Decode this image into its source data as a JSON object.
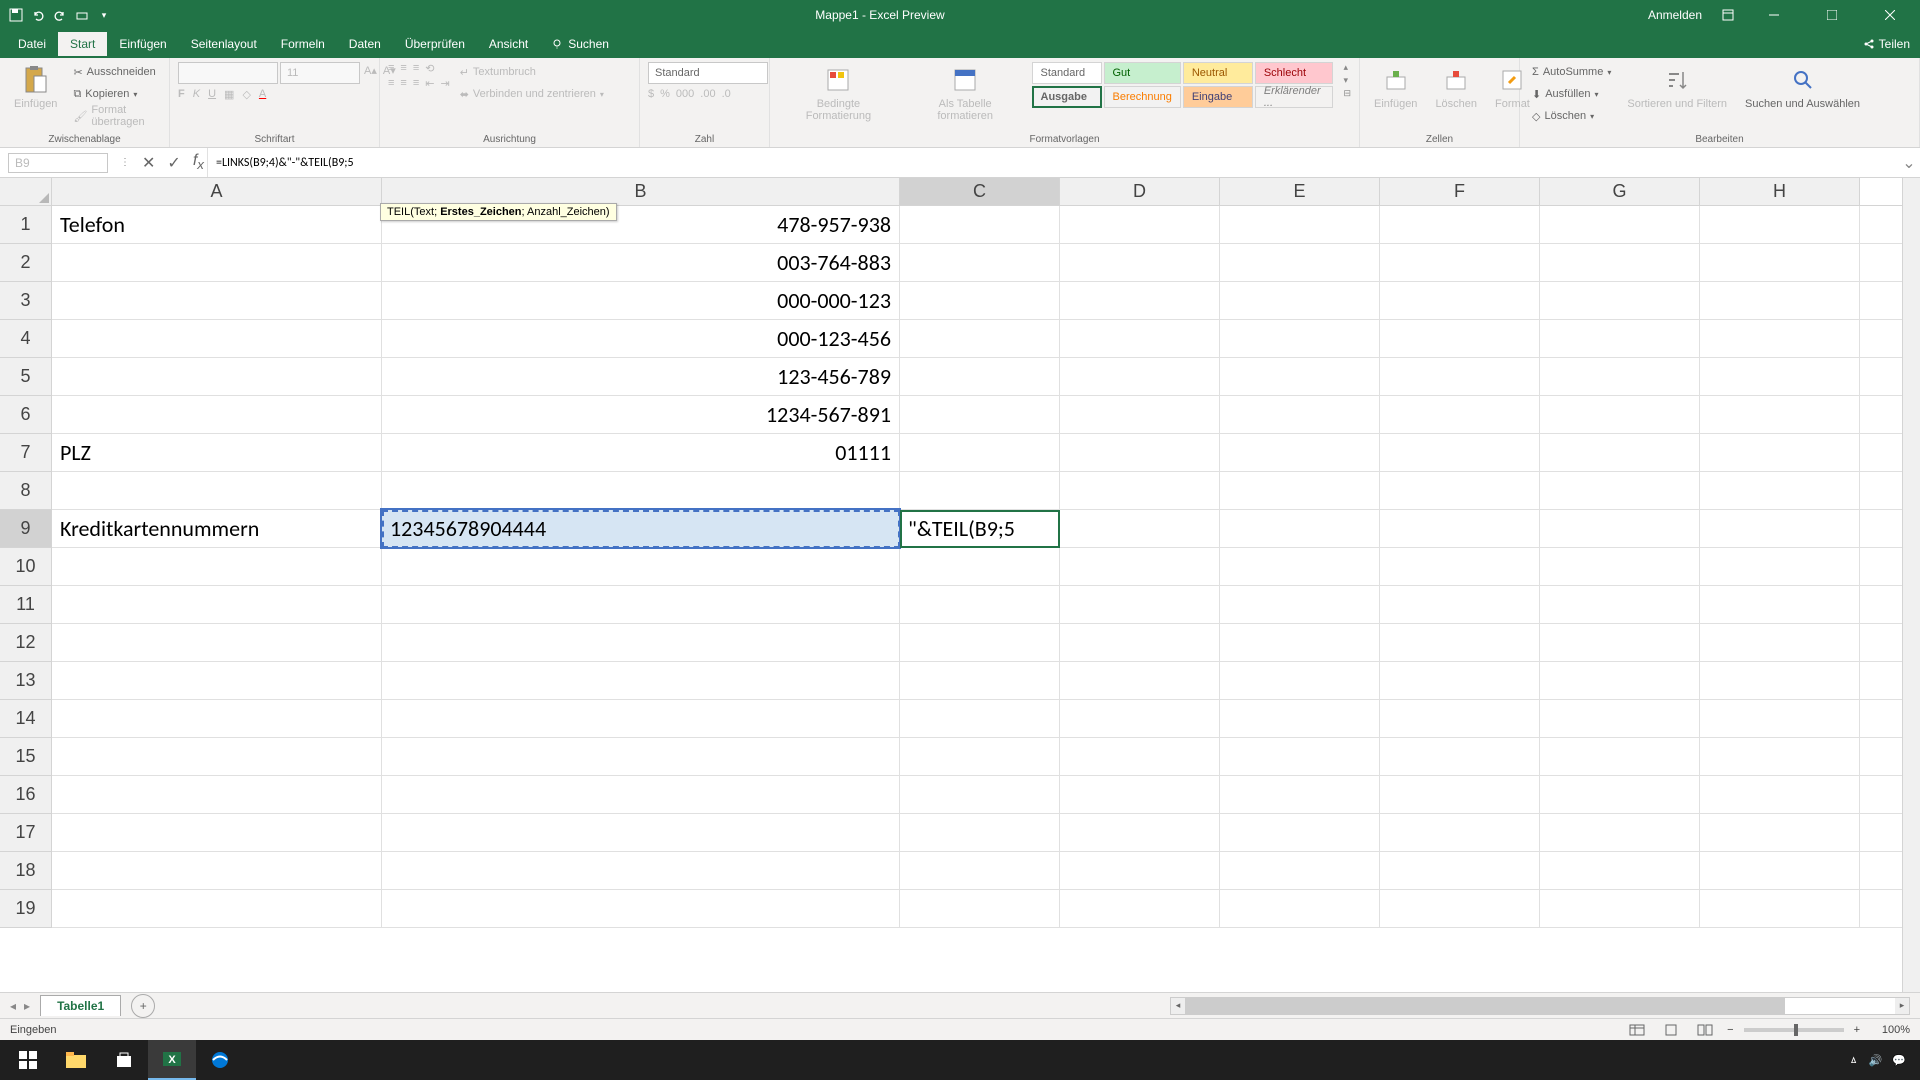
{
  "titlebar": {
    "title": "Mappe1 - Excel Preview",
    "signin": "Anmelden"
  },
  "menu": {
    "items": [
      "Datei",
      "Start",
      "Einfügen",
      "Seitenlayout",
      "Formeln",
      "Daten",
      "Überprüfen",
      "Ansicht"
    ],
    "active_index": 1,
    "search_placeholder": "Suchen",
    "share": "Teilen"
  },
  "ribbon": {
    "clipboard": {
      "paste": "Einfügen",
      "cut": "Ausschneiden",
      "copy": "Kopieren",
      "format_painter": "Format übertragen",
      "label": "Zwischenablage"
    },
    "font": {
      "size": "11",
      "label": "Schriftart"
    },
    "alignment": {
      "wrap": "Textumbruch",
      "merge": "Verbinden und zentrieren",
      "label": "Ausrichtung"
    },
    "number": {
      "format": "Standard",
      "label": "Zahl"
    },
    "styles": {
      "cond": "Bedingte Formatierung",
      "table": "Als Tabelle formatieren",
      "list": [
        "Standard",
        "Gut",
        "Neutral",
        "Schlecht",
        "Ausgabe",
        "Berechnung",
        "Eingabe",
        "Erklärender ..."
      ],
      "label": "Formatvorlagen"
    },
    "cells": {
      "insert": "Einfügen",
      "delete": "Löschen",
      "format": "Format",
      "label": "Zellen"
    },
    "editing": {
      "autosum": "AutoSumme",
      "fill": "Ausfüllen",
      "clear": "Löschen",
      "sort": "Sortieren und Filtern",
      "find": "Suchen und Auswählen",
      "label": "Bearbeiten"
    }
  },
  "formulabar": {
    "namebox": "B9",
    "formula": "=LINKS(B9;4)&\"-\"&TEIL(B9;5",
    "tooltip_prefix": "TEIL(Text; ",
    "tooltip_bold": "Erstes_Zeichen",
    "tooltip_suffix": "; Anzahl_Zeichen)"
  },
  "columns": [
    "A",
    "B",
    "C",
    "D",
    "E",
    "F",
    "G",
    "H"
  ],
  "cells": {
    "A1": "Telefon",
    "B1": "478-957-938",
    "B2": "003-764-883",
    "B3": "000-000-123",
    "B4": "000-123-456",
    "B5": "123-456-789",
    "B6": "1234-567-891",
    "A7": "PLZ",
    "B7": "01111",
    "A9": "Kreditkartennummern",
    "B9": "12345678904444",
    "C9": "\"&TEIL(B9;5"
  },
  "sheets": {
    "active": "Tabelle1"
  },
  "statusbar": {
    "mode": "Eingeben",
    "zoom": "100%"
  },
  "taskbar": {
    "time": ""
  },
  "chart_data": null
}
